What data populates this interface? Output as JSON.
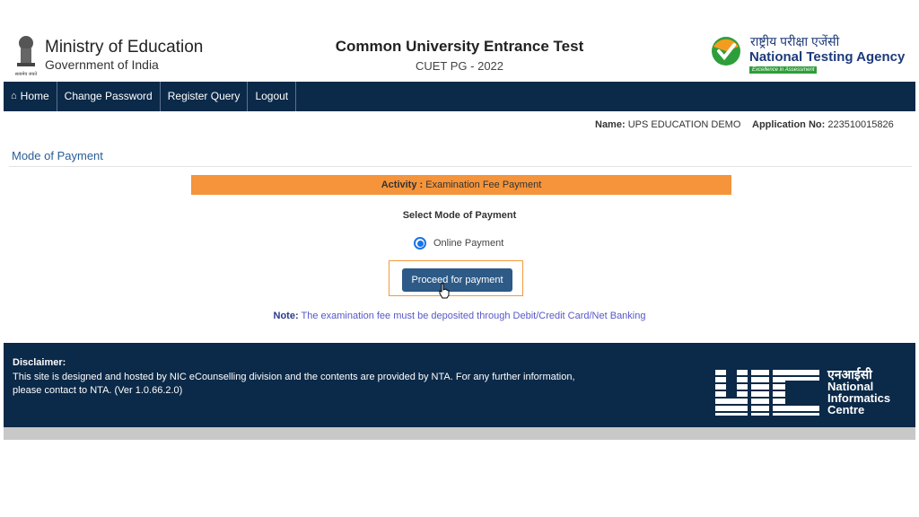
{
  "header": {
    "ministry_title": "Ministry of Education",
    "ministry_sub": "Government of India",
    "emblem_motto": "सत्यमेव जयते",
    "center_title": "Common University Entrance Test",
    "center_sub": "CUET PG - 2022",
    "nta_hindi": "राष्ट्रीय परीक्षा एजेंसी",
    "nta_english": "National Testing Agency",
    "nta_tagline": "Excellence in Assessment"
  },
  "nav": {
    "home": "Home",
    "home_icon": "home-icon",
    "change_password": "Change Password",
    "register_query": "Register Query",
    "logout": "Logout"
  },
  "user": {
    "name_label": "Name:",
    "name_value": "UPS EDUCATION DEMO",
    "appno_label": "Application No:",
    "appno_value": "223510015826"
  },
  "main": {
    "section_title": "Mode of Payment",
    "activity_label": "Activity :",
    "activity_value": "Examination Fee Payment",
    "select_label": "Select Mode of Payment",
    "payment_option": "Online Payment",
    "proceed_button": "Proceed for payment",
    "note_label": "Note:",
    "note_text": "The examination fee must be deposited through Debit/Credit Card/Net Banking"
  },
  "footer": {
    "disclaimer_title": "Disclaimer:",
    "disclaimer_line1": "This site is designed and hosted by NIC eCounselling division and the contents are provided by NTA. For any further information,",
    "disclaimer_line2": "please contact to NTA. (Ver 1.0.66.2.0)",
    "nic_hindi": "एनआईसी",
    "nic_line1": "National",
    "nic_line2": "Informatics",
    "nic_line3": "Centre"
  },
  "colors": {
    "navbar": "#0b2948",
    "activity_bar": "#f5943a",
    "button": "#2d5a86",
    "section_title": "#2b5e96"
  }
}
